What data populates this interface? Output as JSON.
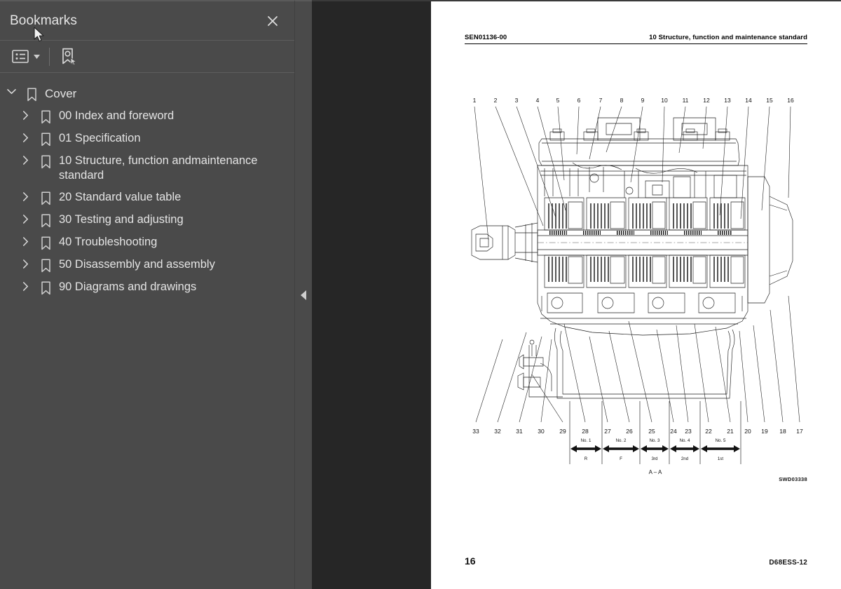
{
  "sidebar": {
    "title": "Bookmarks",
    "close_label": "✕",
    "toolbar": {
      "list_view_icon": "list-view-icon",
      "caret_icon": "chevron-down-icon",
      "new_bookmark_icon": "new-bookmark-icon"
    },
    "tree": [
      {
        "label": "Cover",
        "level": 1,
        "expanded": true,
        "twisty": "chevron-down-icon"
      },
      {
        "label": "00 Index and foreword",
        "level": 2,
        "expanded": false,
        "twisty": "chevron-right-icon"
      },
      {
        "label": "01 Specification",
        "level": 2,
        "expanded": false,
        "twisty": "chevron-right-icon"
      },
      {
        "label": "10 Structure, function andmaintenance standard",
        "level": 2,
        "expanded": false,
        "twisty": "chevron-right-icon"
      },
      {
        "label": "20 Standard value table",
        "level": 2,
        "expanded": false,
        "twisty": "chevron-right-icon"
      },
      {
        "label": "30 Testing and adjusting",
        "level": 2,
        "expanded": false,
        "twisty": "chevron-right-icon"
      },
      {
        "label": "40 Troubleshooting",
        "level": 2,
        "expanded": false,
        "twisty": "chevron-right-icon"
      },
      {
        "label": "50 Disassembly and assembly",
        "level": 2,
        "expanded": false,
        "twisty": "chevron-right-icon"
      },
      {
        "label": "90 Diagrams and drawings",
        "level": 2,
        "expanded": false,
        "twisty": "chevron-right-icon"
      }
    ]
  },
  "splitter": {
    "collapse_icon": "chevron-left-icon"
  },
  "page": {
    "header_left": "SEN01136-00",
    "header_right": "10 Structure, function and maintenance standard",
    "footer_page_number": "16",
    "footer_doc_code": "D68ESS-12",
    "figure": {
      "drawing_code": "SWD03338",
      "section_label": "A – A",
      "top_callouts": [
        "1",
        "2",
        "3",
        "4",
        "5",
        "6",
        "7",
        "8",
        "9",
        "10",
        "11",
        "12",
        "13",
        "14",
        "15",
        "16"
      ],
      "bottom_callouts": [
        "33",
        "32",
        "31",
        "30",
        "29",
        "28",
        "27",
        "26",
        "25",
        "24",
        "23",
        "22",
        "21",
        "20",
        "19",
        "18",
        "17"
      ],
      "clutch_spans": [
        {
          "name": "No. 1",
          "gear": "R"
        },
        {
          "name": "No. 2",
          "gear": "F"
        },
        {
          "name": "No. 3",
          "gear": "3rd"
        },
        {
          "name": "No. 4",
          "gear": "2nd"
        },
        {
          "name": "No. 5",
          "gear": "1st"
        }
      ]
    }
  },
  "colors": {
    "sidebar_bg": "#4a4a4a",
    "viewer_bg": "#262626",
    "page_bg": "#ffffff",
    "text": "#e4e4e4",
    "ink": "#1a1a1a"
  }
}
